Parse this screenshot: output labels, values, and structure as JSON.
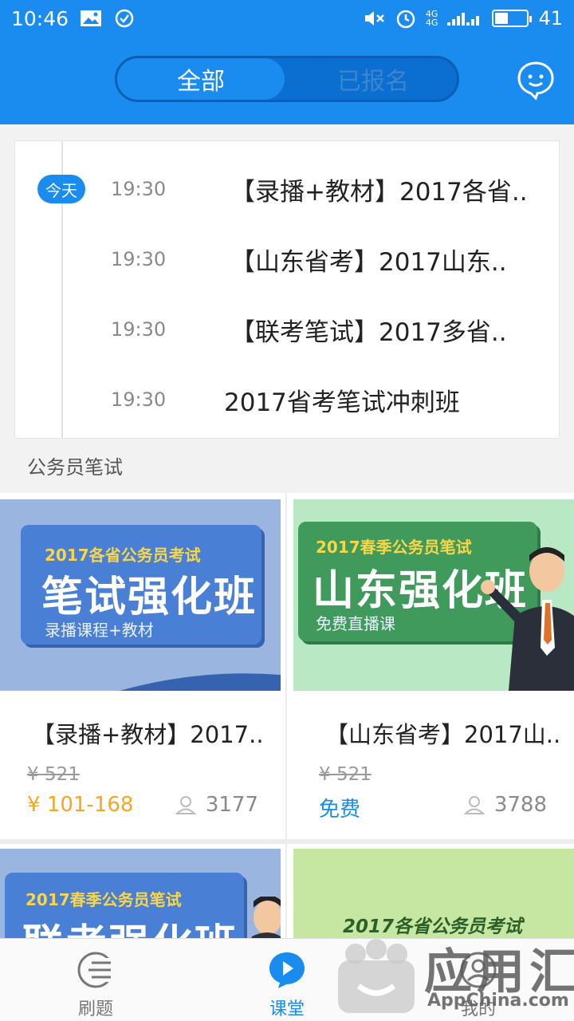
{
  "status_bar": {
    "time": "10:46",
    "network_top": "4G",
    "network_bottom": "4G",
    "battery": "41",
    "battery_level": 0.41
  },
  "header": {
    "tabs": [
      {
        "label": "全部",
        "active": true
      },
      {
        "label": "已报名",
        "active": false
      }
    ]
  },
  "schedule": {
    "today_label": "今天",
    "items": [
      {
        "time": "19:30",
        "title": "【录播+教材】2017各省.."
      },
      {
        "time": "19:30",
        "title": "【山东省考】2017山东.."
      },
      {
        "time": "19:30",
        "title": "【联考笔试】2017多省.."
      },
      {
        "time": "19:30",
        "title": "2017省考笔试冲刺班"
      }
    ]
  },
  "section_title": "公务员笔试",
  "courses": [
    {
      "banner_small": "2017各省公务员考试",
      "banner_big": "笔试强化班",
      "banner_sub": "录播课程+教材",
      "title": "【录播+教材】2017..",
      "old_price": "¥ 521",
      "price": "¥  101-168",
      "count": "3177",
      "price_color": "#f5a623"
    },
    {
      "banner_small": "2017春季公务员笔试",
      "banner_big": "山东强化班",
      "banner_sub": "免费直播课",
      "title": "【山东省考】2017山..",
      "old_price": "¥ 521",
      "price": "免费",
      "count": "3788",
      "price_color": "#1a8cf0"
    },
    {
      "banner_small": "2017春季公务员笔试",
      "banner_big": "联考强化班"
    },
    {
      "banner_small": "2017各省公务员考试"
    }
  ],
  "bottom_nav": [
    {
      "label": "刷题",
      "icon": "list-icon",
      "active": false
    },
    {
      "label": "课堂",
      "icon": "play-chat-icon",
      "active": true
    },
    {
      "label": "我的",
      "icon": "profile-icon",
      "active": false
    }
  ],
  "watermark": {
    "text": "应用汇",
    "domain": "AppChina.com"
  },
  "colors": {
    "primary": "#1a8cf0",
    "price_orange": "#f5a623"
  }
}
